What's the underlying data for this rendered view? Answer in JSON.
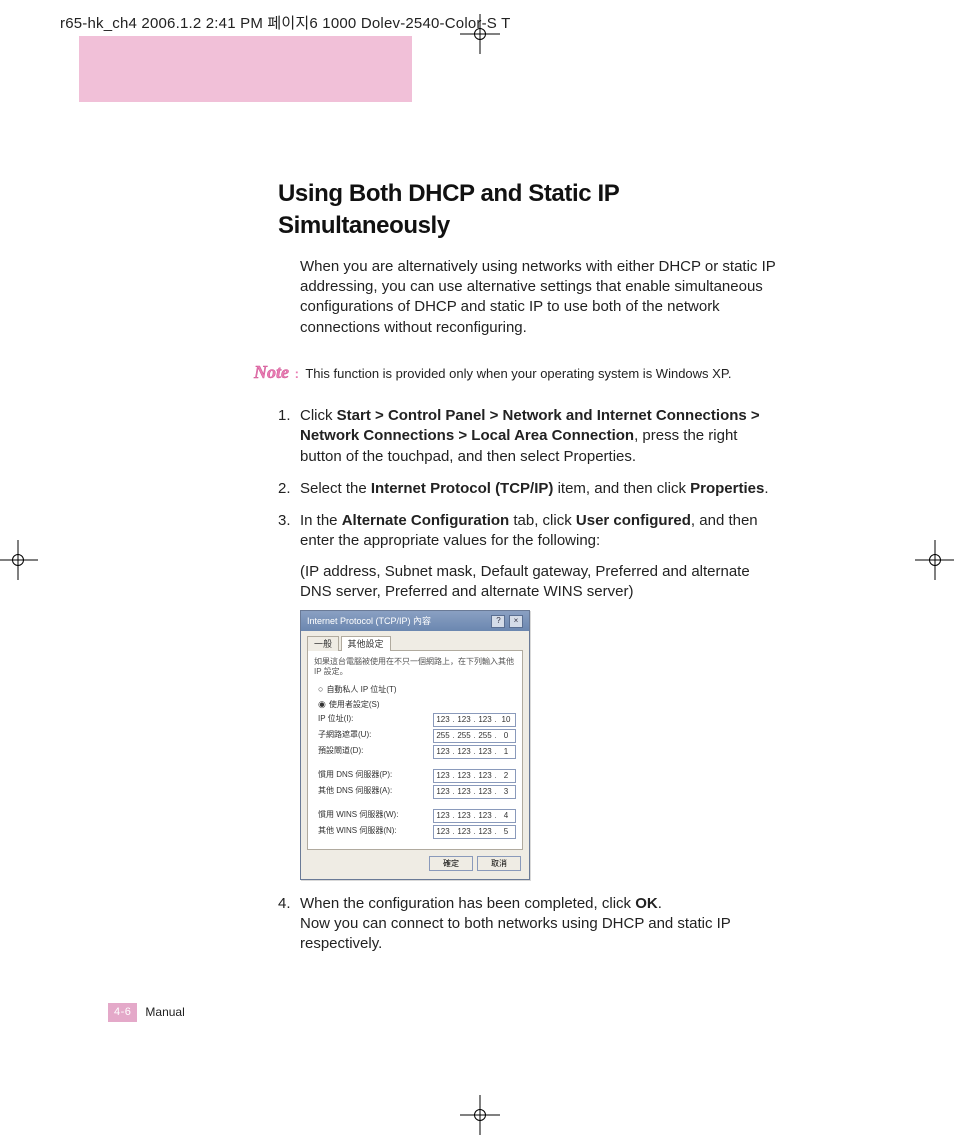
{
  "header_strip": "r65-hk_ch4  2006.1.2 2:41 PM  페이지6   1000 Dolev-2540-Color-S  T",
  "title": "Using Both DHCP and Static IP Simultaneously",
  "intro": "When you are alternatively using networks with either DHCP or static IP addressing, you can use alternative settings that enable simultaneous configurations of DHCP and static IP to use both of the network connections without reconfiguring.",
  "note_label": "Note",
  "note_dots": ":",
  "note_text": "This function is provided only when your operating system is Windows XP.",
  "steps": {
    "s1_pre": "Click ",
    "s1_bold": "Start > Control Panel > Network and Internet Connections > Network Connections > Local Area Connection",
    "s1_post": ", press the right button of the touchpad, and then select Properties.",
    "s2_pre": "Select the ",
    "s2_b1": "Internet Protocol (TCP/IP)",
    "s2_mid": " item, and then click ",
    "s2_b2": "Properties",
    "s2_post": ".",
    "s3_pre": "In the ",
    "s3_b1": "Alternate Configuration",
    "s3_mid": " tab, click ",
    "s3_b2": "User configured",
    "s3_post": ", and then enter the appropriate values for the following:",
    "s3_sub": "(IP address, Subnet mask, Default gateway, Preferred and alternate DNS server, Preferred and alternate WINS server)",
    "s4_pre": "When the configuration has been completed, click ",
    "s4_b1": "OK",
    "s4_post": ".",
    "s4_sub": "Now you can connect to both networks using DHCP and static IP respectively."
  },
  "dialog": {
    "title": "Internet Protocol (TCP/IP) 內容",
    "help_btn": "?",
    "close_btn": "×",
    "tab1": "一般",
    "tab2": "其他設定",
    "desc": "如果這台電腦被使用在不只一個網路上，在下列輸入其他 IP 設定。",
    "radio_auto": "自動私人 IP 位址(T)",
    "radio_user": "使用者設定(S)",
    "row_ip": "IP 位址(I):",
    "row_mask": "子網路遮罩(U):",
    "row_gw": "預設閘道(D):",
    "row_dns1": "慣用 DNS 伺服器(P):",
    "row_dns2": "其他 DNS 伺服器(A):",
    "row_wins1": "慣用 WINS 伺服器(W):",
    "row_wins2": "其他 WINS 伺服器(N):",
    "ip": [
      "123",
      "123",
      "123",
      "10"
    ],
    "mask": [
      "255",
      "255",
      "255",
      "0"
    ],
    "gw": [
      "123",
      "123",
      "123",
      "1"
    ],
    "dns1": [
      "123",
      "123",
      "123",
      "2"
    ],
    "dns2": [
      "123",
      "123",
      "123",
      "3"
    ],
    "wins1": [
      "123",
      "123",
      "123",
      "4"
    ],
    "wins2": [
      "123",
      "123",
      "123",
      "5"
    ],
    "ok": "確定",
    "cancel": "取消"
  },
  "footer": {
    "page": "4-6",
    "label": "Manual"
  }
}
